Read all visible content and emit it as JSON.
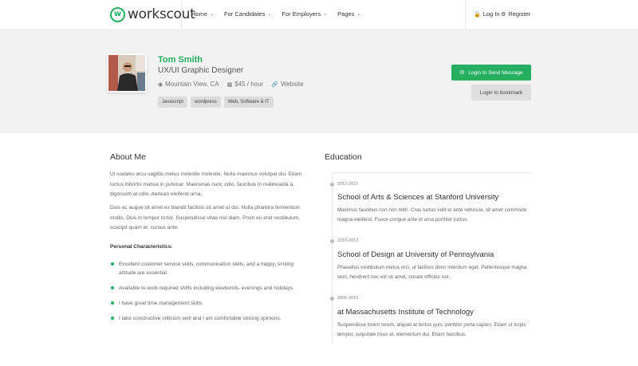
{
  "header": {
    "logo_mark": "w",
    "logo_text": "workscout",
    "nav": [
      {
        "label": "Home"
      },
      {
        "label": "For Candidates"
      },
      {
        "label": "For Employers"
      },
      {
        "label": "Pages"
      }
    ],
    "login_label": "Log In",
    "register_label": "Register",
    "login_icon": "lock-icon",
    "register_icon": "gear-icon"
  },
  "profile": {
    "name": "Tom Smith",
    "role": "UX/UI Graphic Designer",
    "location": "Mountain View, CA",
    "rate": "$45 / hour",
    "website": "Website",
    "tags": [
      "Javascript",
      "wordpress",
      "Web, Software & IT"
    ],
    "message_button": "Login to Send Message",
    "bookmark_button": "Login to bookmark"
  },
  "about": {
    "title": "About Me",
    "paragraphs": [
      "Ut sodales arcu sagittis metus molestie molestie. Nulla maximus volutpat dui. Etiam luctus lobortis massa in pulvinar. Maecenas nunc odio, faucibus in malesuada a, dignissim at odio. Aenean eleifend urna.",
      "Duis ac augue sit amet ex blandit facilisis sit amet ut dui. Nulla pharetra fermentum mollis. Duis in tempor tortor. Suspendisse vitae nisl diam. Proin eu erat vestibulum, suscipit quam et, cursus ante."
    ],
    "characteristics_title": "Personal Characteristics:",
    "characteristics": [
      "Excellent customer service skills, communication skills, and a happy, smiling attitude are essential.",
      "Available to work required shifts including weekends, evenings and holidays.",
      "I have great time management skills.",
      "I take constructive criticism well and I am comfortable voicing opinions."
    ]
  },
  "education": {
    "title": "Education",
    "items": [
      {
        "years": "2012-2015",
        "school": "School of Arts & Sciences at Stanford University",
        "desc": "Maximus faucibus non non nibh. Cras luctus velit et ante vehicula, sit amet commodo magna eleifend. Fusce congue ante id urna porttitor luctus."
      },
      {
        "years": "2010-2012",
        "school": "School of Design at University of Pennsylvania",
        "desc": "Phasellus vestibulum metus orci, ut facilisis dolor interdum eget. Pellentesque magna sem, hendrerit nec elit sit amet, ornare efficitur est."
      },
      {
        "years": "2006-2010",
        "school": "at Massachusetts Institute of Technology",
        "desc": "Suspendisse lorem lorem, aliquet at lectus quis, porttitor porta sapien. Etiam ut turpis tempor, vulputate risus at, elementum dui. Etiam faucibus."
      }
    ]
  },
  "colors": {
    "accent": "#26ae61",
    "banner_bg": "#f2f2f2"
  }
}
